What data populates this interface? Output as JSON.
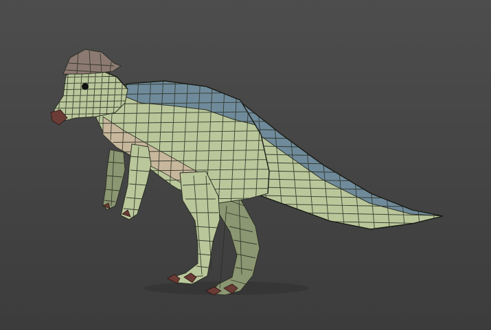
{
  "viewport": {
    "background_top": "#4d4d4d",
    "background_bottom": "#3c3c3c"
  },
  "model": {
    "name": "dinosaur-mesh",
    "colors": {
      "skin": "#b9c79b",
      "skin_shadow": "#8b9672",
      "back_stripe": "#6f8b9b",
      "belly": "#c7b79c",
      "crest": "#8c7a72",
      "claws": "#6b3b35",
      "wireframe": "#2b2f23",
      "eye": "#111111"
    }
  }
}
